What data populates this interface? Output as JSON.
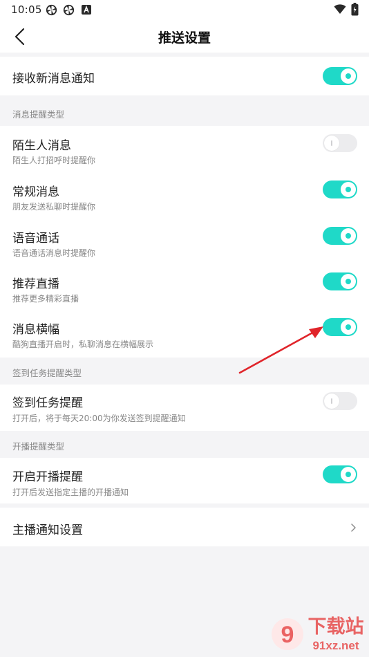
{
  "status_bar": {
    "time": "10:05",
    "icons": [
      "pinwheel-icon",
      "pinwheel-icon",
      "a-box-icon",
      "wifi-icon",
      "battery-icon"
    ]
  },
  "header": {
    "title": "推送设置",
    "back_icon": "back-chevron-icon"
  },
  "settings": {
    "receive_new": {
      "title": "接收新消息通知",
      "enabled": true
    },
    "section_reminder_type": "消息提醒类型",
    "stranger": {
      "title": "陌生人消息",
      "subtitle": "陌生人打招呼时提醒你",
      "enabled": false
    },
    "regular": {
      "title": "常规消息",
      "subtitle": "朋友发送私聊时提醒你",
      "enabled": true
    },
    "voice": {
      "title": "语音通话",
      "subtitle": "语音通话消息时提醒你",
      "enabled": true
    },
    "recommend_live": {
      "title": "推荐直播",
      "subtitle": "推荐更多精彩直播",
      "enabled": true
    },
    "banner": {
      "title": "消息横幅",
      "subtitle": "酷狗直播开启时，私聊消息在横幅展示",
      "enabled": true
    },
    "section_checkin_type": "签到任务提醒类型",
    "checkin": {
      "title": "签到任务提醒",
      "subtitle": "打开后，将于每天20:00为你发送签到提醒通知",
      "enabled": false
    },
    "section_live_type": "开播提醒类型",
    "live_start": {
      "title": "开启开播提醒",
      "subtitle": "打开后发送指定主播的开播通知",
      "enabled": true
    },
    "host_notify": {
      "title": "主播通知设置",
      "icon": "chevron-right-icon"
    }
  },
  "colors": {
    "accent": "#1fd9c8",
    "toggle_off": "#ececee",
    "annotation_arrow": "#e0242a",
    "background": "#f4f4f6"
  },
  "watermark": {
    "brand_text": "下载站",
    "site_text": "91xz.net"
  }
}
